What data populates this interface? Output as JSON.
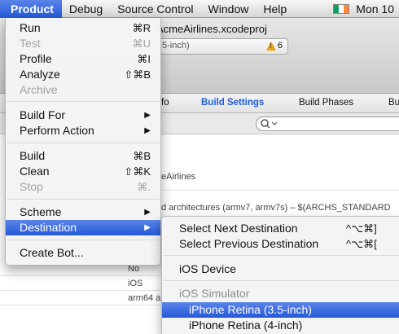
{
  "menubar": {
    "items": [
      {
        "label": "Product",
        "active": true
      },
      {
        "label": "Debug",
        "active": false
      },
      {
        "label": "Source Control",
        "active": false
      },
      {
        "label": "Window",
        "active": false
      },
      {
        "label": "Help",
        "active": false
      }
    ],
    "flag_icon": "ireland-flag-icon",
    "clock": "Mon 10"
  },
  "window": {
    "title": "AcmeAirlines.xcodeproj",
    "activity_text": "5-inch)",
    "warning_count": "6",
    "tabs": [
      "fo",
      "Build Settings",
      "Build Phases",
      "Bu"
    ],
    "active_tab": "Build Settings",
    "content": {
      "project_label": "eAirlines",
      "architectures_row": "d architectures (armv7, armv7s)  –  $(ARCHS_STANDARD",
      "value_1": "No",
      "value_2": "iOS",
      "value_3": "arm64 ar"
    }
  },
  "product_menu": {
    "run": {
      "label": "Run",
      "shortcut": "⌘R"
    },
    "test": {
      "label": "Test",
      "shortcut": "⌘U"
    },
    "profile": {
      "label": "Profile",
      "shortcut": "⌘I"
    },
    "analyze": {
      "label": "Analyze",
      "shortcut": "⇧⌘B"
    },
    "archive": {
      "label": "Archive"
    },
    "build_for": {
      "label": "Build For"
    },
    "perform_action": {
      "label": "Perform Action"
    },
    "build": {
      "label": "Build",
      "shortcut": "⌘B"
    },
    "clean": {
      "label": "Clean",
      "shortcut": "⇧⌘K"
    },
    "stop": {
      "label": "Stop",
      "shortcut": "⌘."
    },
    "scheme": {
      "label": "Scheme"
    },
    "destination": {
      "label": "Destination"
    },
    "create_bot": {
      "label": "Create Bot..."
    },
    "submenu_arrow": "▶"
  },
  "destination_submenu": {
    "next": {
      "label": "Select Next Destination",
      "shortcut": "^⌥⌘]"
    },
    "previous": {
      "label": "Select Previous Destination",
      "shortcut": "^⌥⌘["
    },
    "ios_device": "iOS Device",
    "ios_simulator_header": "iOS Simulator",
    "simulators": [
      "iPhone Retina (3.5-inch)",
      "iPhone Retina (4-inch)"
    ],
    "selected": "iPhone Retina (3.5-inch)"
  },
  "colors": {
    "highlight": "#2f62dc",
    "link_blue": "#1f5bd6",
    "warning": "#e8a317"
  }
}
